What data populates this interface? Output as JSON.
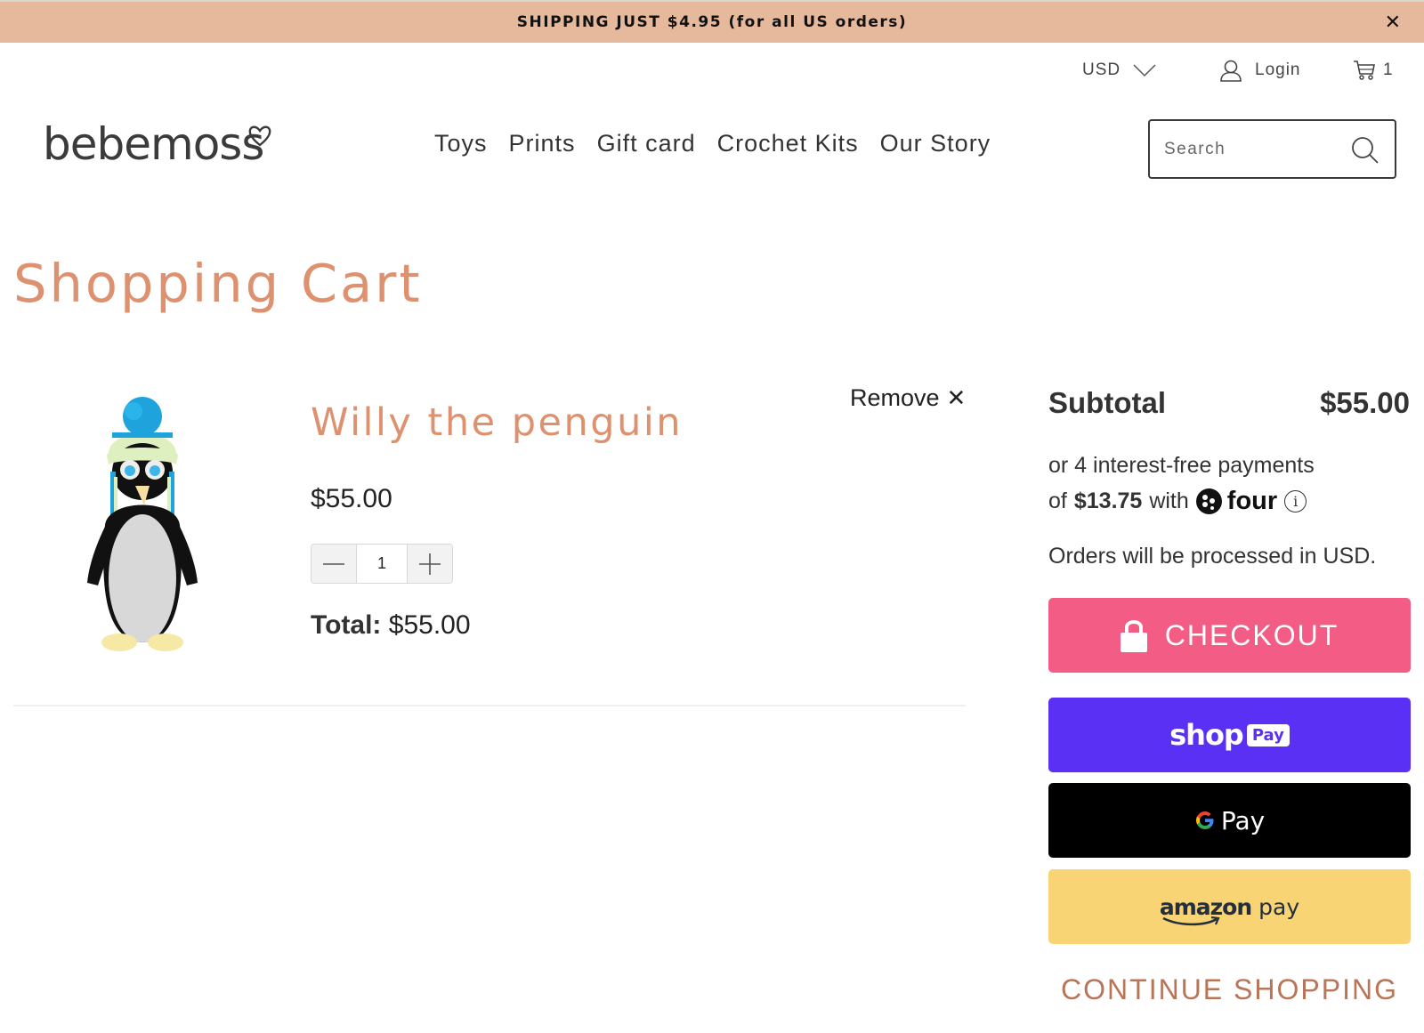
{
  "announcement": {
    "text": "SHIPPING JUST $4.95 (for all US orders)",
    "close_label": "✕"
  },
  "utility": {
    "currency": "USD",
    "login_label": "Login",
    "cart_count": "1"
  },
  "header": {
    "logo_text": "bebemoss",
    "nav": [
      {
        "label": "Toys"
      },
      {
        "label": "Prints"
      },
      {
        "label": "Gift card"
      },
      {
        "label": "Crochet Kits"
      },
      {
        "label": "Our Story"
      }
    ],
    "search_placeholder": "Search"
  },
  "page": {
    "title": "Shopping Cart"
  },
  "cart": {
    "items": [
      {
        "title": "Willy the penguin",
        "price": "$55.00",
        "quantity": "1",
        "total_label": "Total:",
        "total_value": "$55.00",
        "remove_label": "Remove",
        "remove_icon": "✕"
      }
    ]
  },
  "summary": {
    "subtotal_label": "Subtotal",
    "subtotal_value": "$55.00",
    "installments_line1": "or 4 interest-free payments",
    "installments_of": "of",
    "installment_amount": "$13.75",
    "installments_with": "with",
    "installment_provider": "four",
    "currency_note": "Orders will be processed in USD.",
    "checkout_label": "CHECKOUT",
    "shoppay_label": "shop",
    "shoppay_badge": "Pay",
    "gpay_label": "Pay",
    "amazon_label_brand": "amazon",
    "amazon_label_pay": "pay",
    "continue_label": "CONTINUE SHOPPING"
  },
  "colors": {
    "announcement_bg": "#e6b99d",
    "accent": "#de916f",
    "checkout": "#f25c85",
    "shoppay": "#5a31f4",
    "gpay": "#000000",
    "amazon": "#f8d475",
    "continue": "#b87558"
  }
}
